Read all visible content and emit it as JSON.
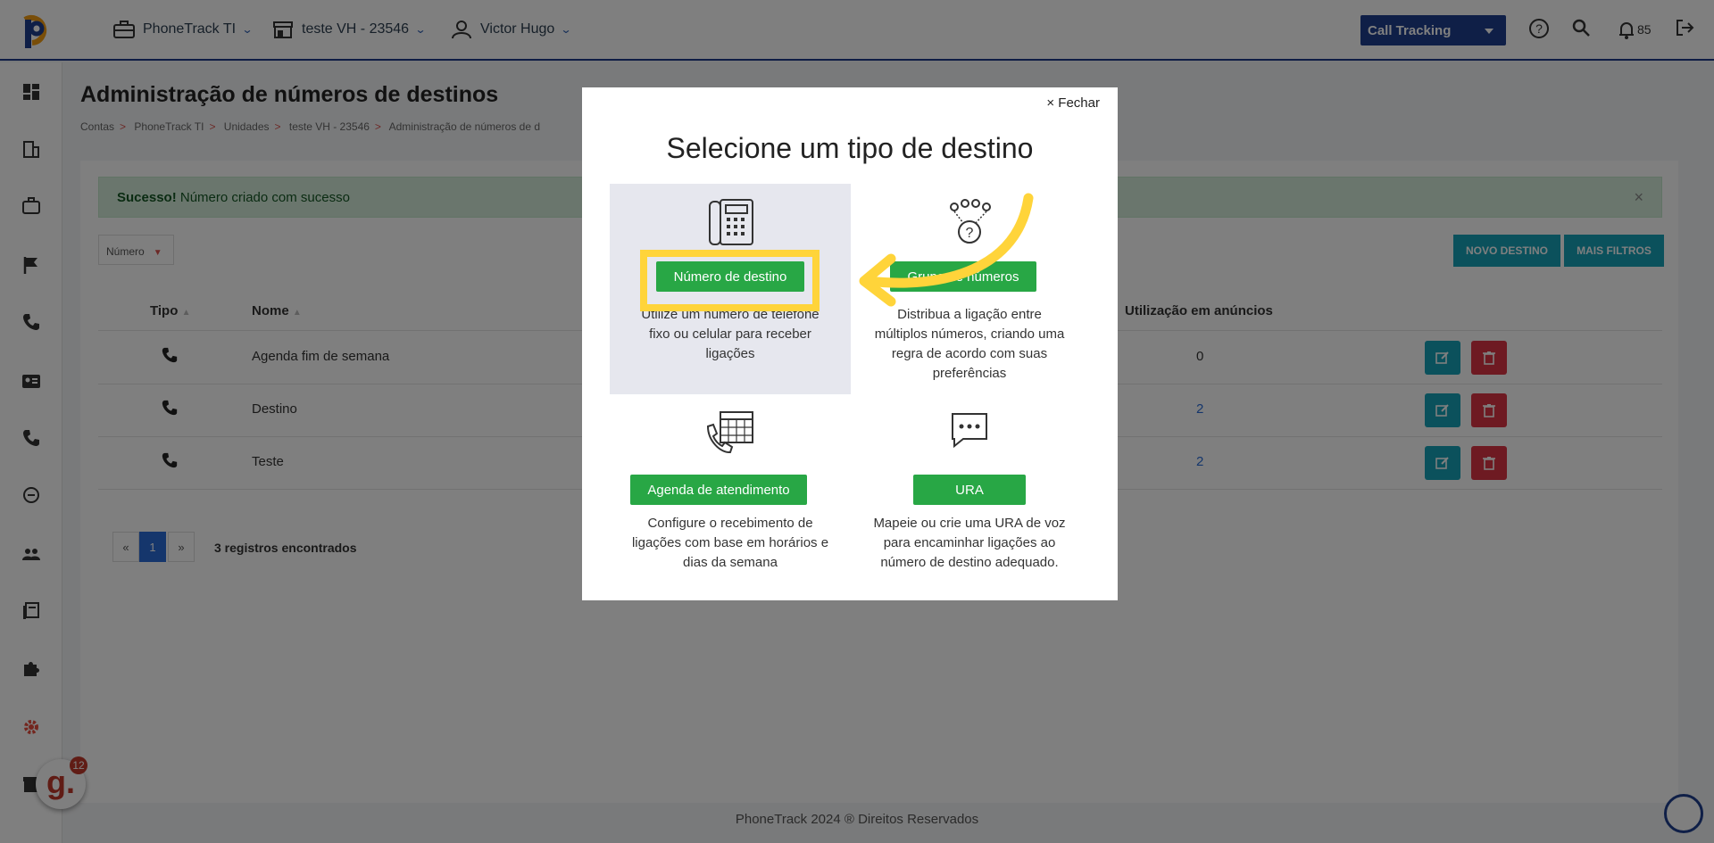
{
  "topbar": {
    "account": "PhoneTrack TI",
    "unit": "teste VH - 23546",
    "user": "Victor Hugo",
    "product_select": "Call Tracking",
    "notifications_count": "85"
  },
  "page": {
    "title": "Administração de números de destinos",
    "breadcrumb": [
      "Contas",
      "PhoneTrack TI",
      "Unidades",
      "teste VH - 23546",
      "Administração de números de d"
    ]
  },
  "alert": {
    "strong": "Sucesso!",
    "text": "Número criado com sucesso",
    "close": "×"
  },
  "filter": {
    "label": "Número"
  },
  "buttons": {
    "new_destination": "NOVO DESTINO",
    "more_filters": "MAIS FILTROS"
  },
  "table": {
    "headers": {
      "type": "Tipo",
      "name": "Nome",
      "usage": "Utilização em anúncios"
    },
    "rows": [
      {
        "name": "Agenda fim de semana",
        "usage": "0"
      },
      {
        "name": "Destino",
        "usage": "2"
      },
      {
        "name": "Teste",
        "usage": "2"
      }
    ]
  },
  "pagination": {
    "prev": "«",
    "current": "1",
    "next": "»",
    "records": "3 registros encontrados"
  },
  "footer": "PhoneTrack 2024 ® Direitos Reservados",
  "badge": {
    "letter": "g.",
    "count": "12"
  },
  "modal": {
    "close": "× Fechar",
    "title": "Selecione um tipo de destino",
    "options": [
      {
        "button": "Número de destino",
        "lines": [
          "Utilize um número de telefone",
          "fixo ou celular para receber",
          "ligações"
        ]
      },
      {
        "button": "Grupo de números",
        "lines": [
          "Distribua a ligação entre",
          "múltiplos números, criando uma",
          "regra de acordo com suas",
          "preferências"
        ]
      },
      {
        "button": "Agenda de atendimento",
        "lines": [
          "Configure o recebimento de",
          "ligações com base em horários e",
          "dias da semana"
        ]
      },
      {
        "button": "URA",
        "lines": [
          "Mapeie ou crie uma URA de voz",
          "para encaminhar ligações ao",
          "número de destino adequado."
        ]
      }
    ]
  },
  "colors": {
    "highlight": "#ffd43a",
    "green": "#28a745",
    "teal": "#17a2b8",
    "navy": "#1f3f8f"
  }
}
